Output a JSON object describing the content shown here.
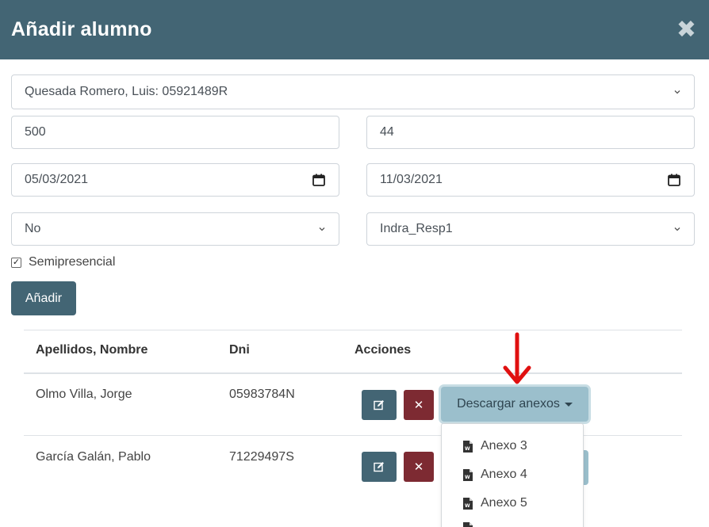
{
  "modal": {
    "title": "Añadir alumno",
    "close_symbol": "✖"
  },
  "form": {
    "student_select": "Quesada Romero, Luis: 05921489R",
    "field_left_1": "500",
    "field_right_1": "44",
    "date_start": "05/03/2021",
    "date_end": "11/03/2021",
    "select_left": "No",
    "select_right": "Indra_Resp1",
    "checkbox_label": "Semipresencial",
    "checkbox_checked": true,
    "submit_label": "Añadir"
  },
  "table": {
    "headers": [
      "Apellidos, Nombre",
      "Dni",
      "Acciones"
    ],
    "rows": [
      {
        "name": "Olmo Villa, Jorge",
        "dni": "05983784N"
      },
      {
        "name": "García Galán, Pablo",
        "dni": "71229497S"
      }
    ],
    "download_label": "Descargar anexos"
  },
  "dropdown": {
    "items": [
      "Anexo 3",
      "Anexo 4",
      "Anexo 5"
    ]
  },
  "colors": {
    "header_bg": "#436574",
    "primary": "#436574",
    "danger": "#7d2a32",
    "download_bg": "#9bbfcc",
    "annotation_arrow": "#e01010"
  }
}
